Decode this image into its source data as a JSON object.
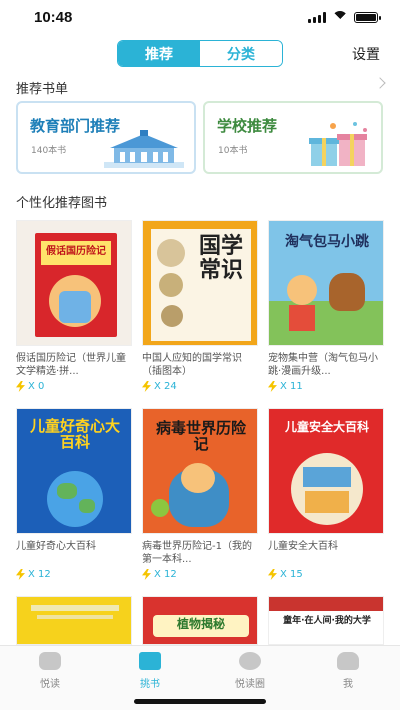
{
  "status_bar": {
    "time": "10:48"
  },
  "header": {
    "tabs": [
      {
        "label": "推荐",
        "active": true
      },
      {
        "label": "分类",
        "active": false
      }
    ],
    "settings_label": "设置"
  },
  "recommend_lists": {
    "title": "推荐书单",
    "cards": [
      {
        "title": "教育部门推荐",
        "count": "140本书"
      },
      {
        "title": "学校推荐",
        "count": "10本书"
      }
    ]
  },
  "personal": {
    "title": "个性化推荐图书",
    "books": [
      {
        "title": "假话国历险记（世界儿童文学精选·拼...",
        "count": "X 0",
        "cover_text": "假话国历险记"
      },
      {
        "title": "中国人应知的国学常识（插图本）",
        "count": "X 24",
        "cover_text": "国学常识"
      },
      {
        "title": "宠物集中营（淘气包马小跳·漫画升级...",
        "count": "X 11",
        "cover_text": "淘气包马小跳"
      },
      {
        "title": "儿童好奇心大百科",
        "count": "X 12",
        "cover_text": "儿童好奇心大百科"
      },
      {
        "title": "病毒世界历险记-1（我的第一本科...",
        "count": "X 12",
        "cover_text": "病毒世界历险记"
      },
      {
        "title": "儿童安全大百科",
        "count": "X 15",
        "cover_text": "儿童安全大百科"
      }
    ],
    "partial_covers": [
      "",
      "植物揭秘",
      "童年·在人间·我的大学"
    ]
  },
  "tabbar": {
    "items": [
      {
        "label": "悦读",
        "active": false
      },
      {
        "label": "挑书",
        "active": true
      },
      {
        "label": "悦读圈",
        "active": false
      },
      {
        "label": "我",
        "active": false
      }
    ]
  },
  "colors": {
    "accent": "#2bb3d6",
    "bolt": "#f5c400"
  }
}
